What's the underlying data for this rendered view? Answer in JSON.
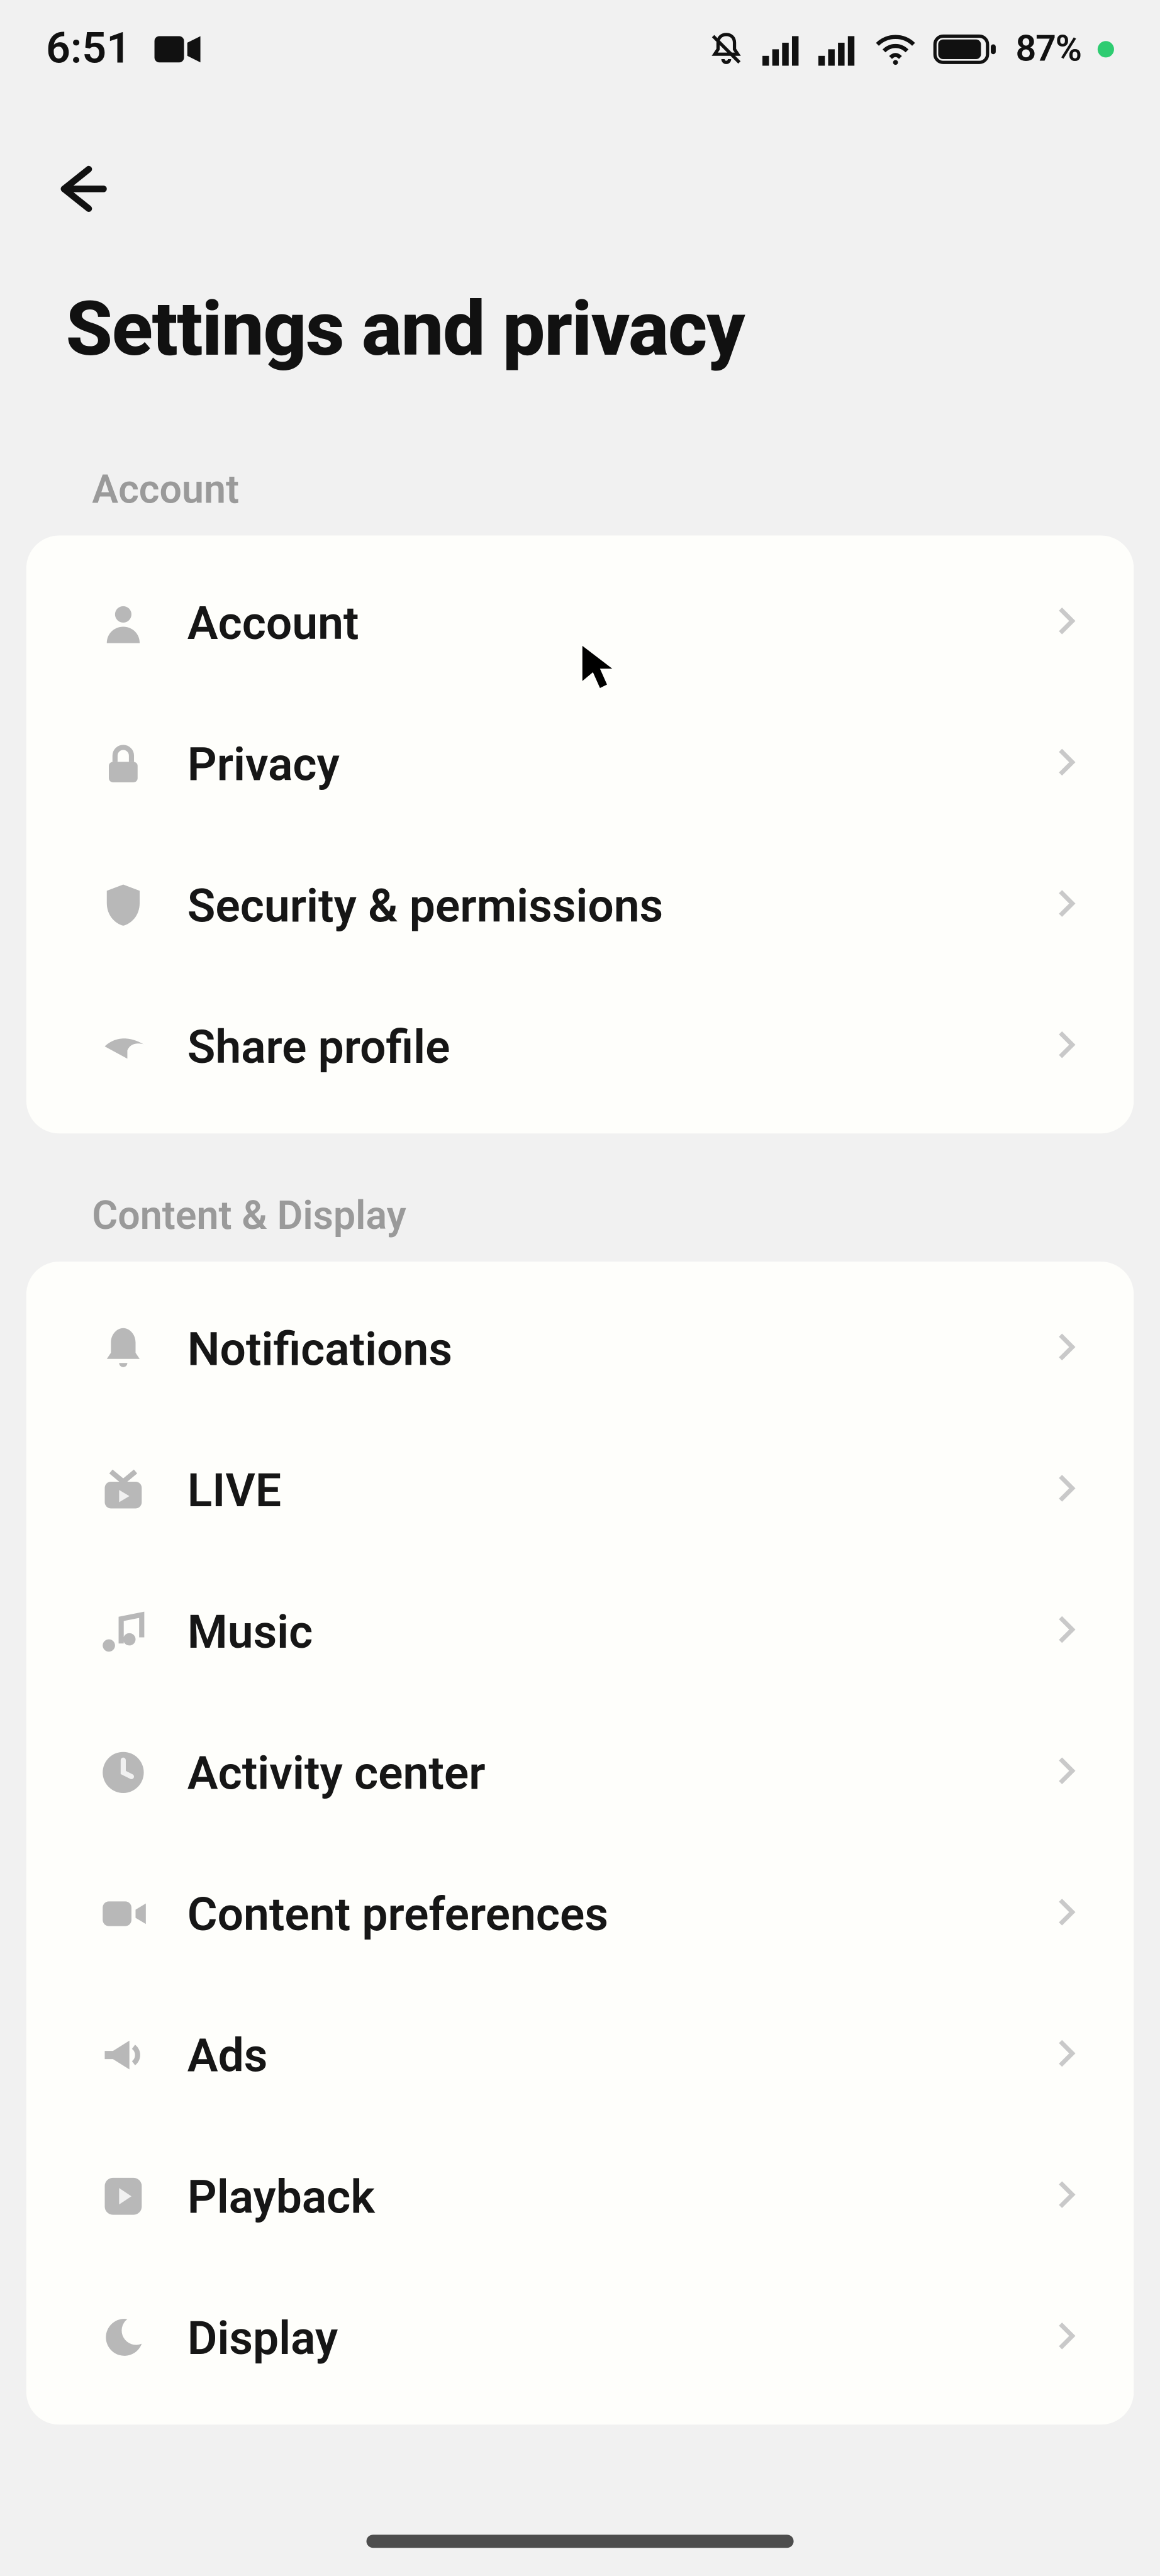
{
  "status": {
    "time": "6:51",
    "battery_pct": "87%"
  },
  "header": {
    "title": "Settings and privacy"
  },
  "sections": [
    {
      "label": "Account",
      "items": [
        {
          "icon": "person",
          "label": "Account"
        },
        {
          "icon": "lock",
          "label": "Privacy"
        },
        {
          "icon": "shield",
          "label": "Security & permissions"
        },
        {
          "icon": "share",
          "label": "Share profile"
        }
      ]
    },
    {
      "label": "Content & Display",
      "items": [
        {
          "icon": "bell",
          "label": "Notifications"
        },
        {
          "icon": "live",
          "label": "LIVE"
        },
        {
          "icon": "music",
          "label": "Music"
        },
        {
          "icon": "clock",
          "label": "Activity center"
        },
        {
          "icon": "video",
          "label": "Content preferences"
        },
        {
          "icon": "megaphone",
          "label": "Ads"
        },
        {
          "icon": "play",
          "label": "Playback"
        },
        {
          "icon": "moon",
          "label": "Display"
        }
      ]
    }
  ]
}
